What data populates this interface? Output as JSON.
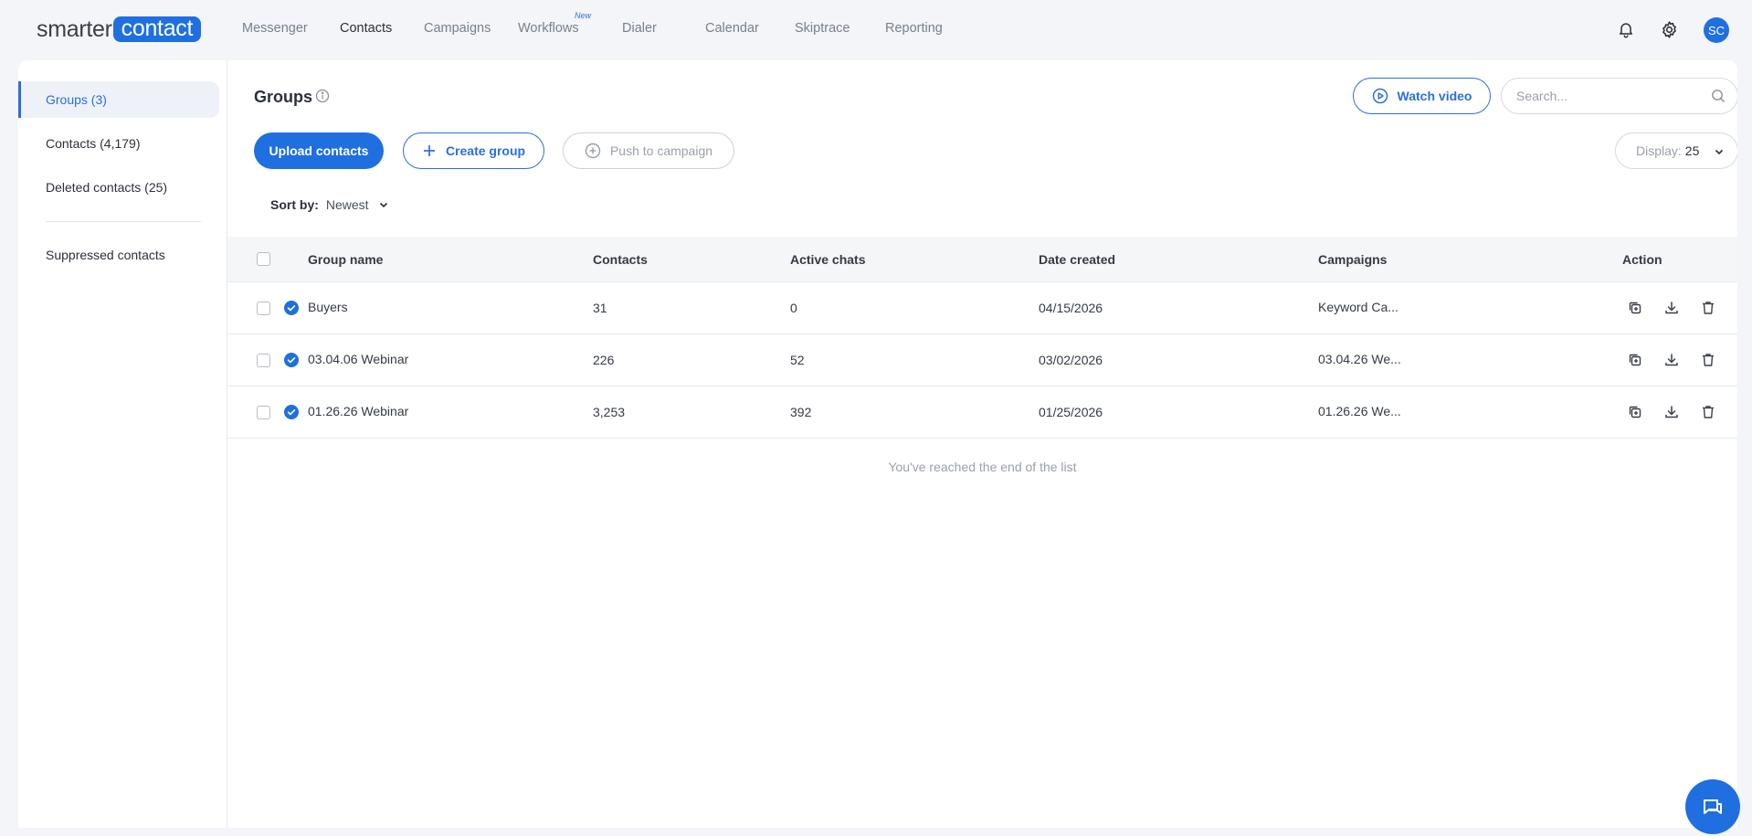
{
  "brand": {
    "word1": "smarter",
    "word2": "contact"
  },
  "nav": {
    "items": [
      {
        "label": "Messenger",
        "active": false
      },
      {
        "label": "Contacts",
        "active": true
      },
      {
        "label": "Campaigns",
        "active": false
      },
      {
        "label": "Workflows",
        "active": false,
        "badge": "New"
      },
      {
        "label": "Dialer",
        "active": false
      },
      {
        "label": "Calendar",
        "active": false
      },
      {
        "label": "Skiptrace",
        "active": false
      },
      {
        "label": "Reporting",
        "active": false
      }
    ],
    "avatar_initials": "SC"
  },
  "sidebar": {
    "items": [
      {
        "label": "Groups (3)",
        "active": true
      },
      {
        "label": "Contacts (4,179)",
        "active": false
      },
      {
        "label": "Deleted contacts (25)",
        "active": false
      },
      {
        "label": "Suppressed contacts",
        "active": false
      }
    ]
  },
  "page": {
    "title": "Groups",
    "watch_video_label": "Watch video",
    "search_placeholder": "Search...",
    "upload_label": "Upload contacts",
    "create_group_label": "Create group",
    "push_label": "Push to campaign",
    "display_label": "Display:",
    "display_value": "25",
    "sort_label": "Sort by:",
    "sort_value": "Newest",
    "end_note": "You've reached the end of the list"
  },
  "table": {
    "columns": [
      "Group name",
      "Contacts",
      "Active chats",
      "Date created",
      "Campaigns",
      "Action"
    ],
    "rows": [
      {
        "name": "Buyers",
        "contacts": "31",
        "active_chats": "0",
        "date": "04/15/2026",
        "campaigns": "Keyword Ca..."
      },
      {
        "name": "03.04.06 Webinar",
        "contacts": "226",
        "active_chats": "52",
        "date": "03/02/2026",
        "campaigns": "03.04.26 We..."
      },
      {
        "name": "01.26.26 Webinar",
        "contacts": "3,253",
        "active_chats": "392",
        "date": "01/25/2026",
        "campaigns": "01.26.26 We..."
      }
    ]
  },
  "colors": {
    "accent": "#1f6fe0",
    "text": "#343a45",
    "muted": "#9aa0a9",
    "background": "#f3f5f8"
  },
  "icons": [
    "bell-icon",
    "gear-icon",
    "info-icon",
    "play-circle-icon",
    "search-icon",
    "plus-icon",
    "plus-circle-icon",
    "chevron-down-icon",
    "check-circle-icon",
    "copy-icon",
    "download-icon",
    "trash-icon",
    "chat-icon"
  ]
}
